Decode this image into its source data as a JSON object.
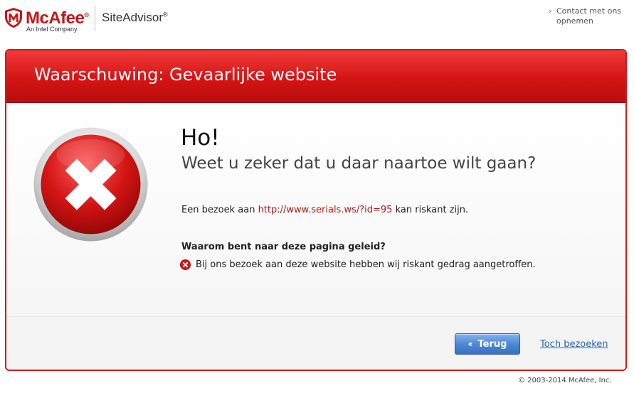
{
  "header": {
    "logo_word": "McAfee",
    "logo_registered": "®",
    "logo_tagline": "An Intel Company",
    "product_name": "SiteAdvisor",
    "product_registered": "®",
    "contact_link": "Contact met ons opnemen"
  },
  "panel": {
    "title": "Waarschuwing: Gevaarlijke website",
    "hello": "Ho!",
    "question": "Weet u zeker dat u daar naartoe wilt gaan?",
    "visit_prefix": "Een bezoek aan",
    "visit_url": "http://www.serials.ws/?id=95",
    "visit_suffix": "kan riskant zijn.",
    "reason_heading": "Waarom bent naar deze pagina geleid?",
    "reasons": [
      "Bij ons bezoek aan deze website hebben wij riskant gedrag aangetroffen."
    ]
  },
  "footer": {
    "back_button": "Terug",
    "visit_anyway": "Toch bezoeken",
    "copyright": "© 2003-2014 McAfee, Inc."
  },
  "colors": {
    "brand_red": "#c01818",
    "header_red": "#d41414",
    "link_red": "#b01c1c",
    "button_blue": "#4f88d8",
    "link_blue": "#2a66b5"
  },
  "icons": {
    "logo": "mcafee-shield-icon",
    "warning": "red-x-circle-icon",
    "reason": "small-red-x-icon",
    "back": "chevron-left-icon",
    "contact": "chevron-right-icon"
  }
}
